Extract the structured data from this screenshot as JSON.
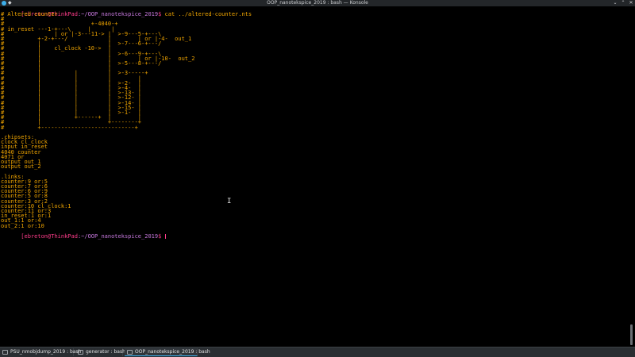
{
  "window": {
    "title": "OOP_nanotekspice_2019 : bash — Konsole"
  },
  "terminal": {
    "prompt": {
      "user": "[ebreton@ThinkPad",
      "path": ":~/OOP_nanotekspice_2019",
      "symbol": "$",
      "command": " cat ../altered-counter.nts"
    },
    "output_lines": [
      "# Altered counter",
      "#",
      "#                          +-4040-+",
      "# in_reset ---1-+---\\     |      |",
      "#               | or |-3---11-> |  >-9---5-+---\\",
      "#          +-2-+---/            |        | or |-4-  out_1",
      "#          |                    |  >-7---6-+---/",
      "#          |    cl_clock -10->  |        ",
      "#          |                    |  >-6---9-+---\\",
      "#          |                    |        | or |-10-  out_2",
      "#          |                    |  >-5---8-+---/",
      "#          |                    |        ",
      "#          |          |         |  >-3-----+",
      "#          |          |         |        |",
      "#          |          |         |  >-2-  |",
      "#          |          |         |  >-4-  |",
      "#          |          |         |  >-13- |",
      "#          |          |         |  >-12- |",
      "#          |          |         |  >-14- |",
      "#          |          |         |  >-15- |",
      "#          |          |         |  >-1-  |",
      "#          |          +------+  |        |",
      "#          |                    +--------+",
      "#          +----------------------------+",
      "",
      ".chipsets:",
      "clock cl_clock",
      "input in_reset",
      "4040 counter",
      "4071 or",
      "output out_1",
      "output out_2",
      "",
      ".links:",
      "counter:9 or:5",
      "counter:7 or:6",
      "counter:6 or:9",
      "counter:5 or:8",
      "counter:3 or:2",
      "counter:10 cl_clock:1",
      "counter:11 or:3",
      "in_reset:1 or:1",
      "out_1:1 or:4",
      "out_2:1 or:10"
    ]
  },
  "tabs": [
    {
      "label": "PSU_nmobjdump_2019 : bash"
    },
    {
      "label": "generator : bash"
    },
    {
      "label": "OOP_nanotekspice_2019 : bash"
    }
  ],
  "colors": {
    "prompt_user": "#ff3c8a",
    "prompt_path": "#c678dd",
    "output_text": "#f0a500",
    "background": "#000000"
  },
  "icons": {
    "window_icon": "konsole-icon",
    "minimize": "minimize-icon",
    "maximize": "maximize-icon",
    "close": "close-icon",
    "mouse_cursor": "ibeam-cursor-icon"
  }
}
